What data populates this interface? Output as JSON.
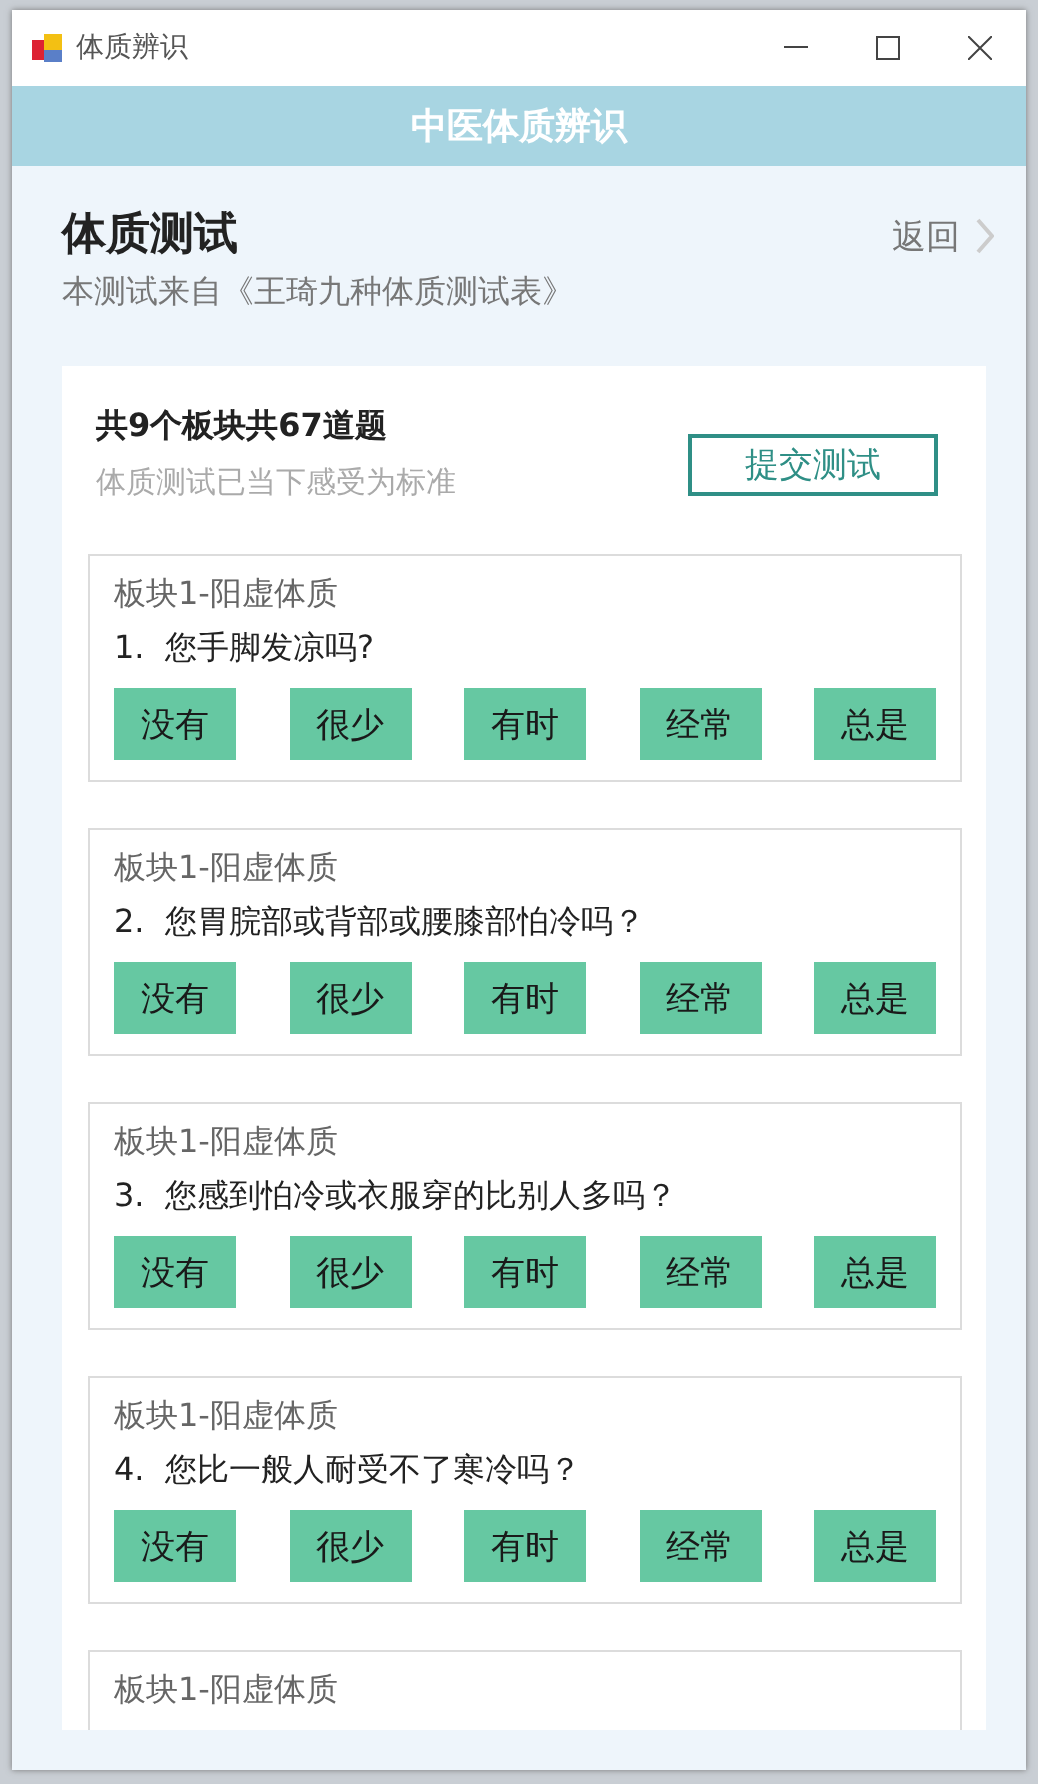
{
  "window": {
    "title": "体质辨识"
  },
  "app_header": {
    "title": "中医体质辨识"
  },
  "page": {
    "title": "体质测试",
    "subtitle": "本测试来自《王琦九种体质测试表》",
    "back_link": "返回"
  },
  "summary": {
    "count": "共9个板块共67道题",
    "hint": "体质测试已当下感受为标准",
    "submit_button": "提交测试"
  },
  "questions": [
    {
      "category": "板块1-阳虚体质",
      "question": "1.  您手脚发凉吗?",
      "options": [
        {
          "label": "没有",
          "selected": false
        },
        {
          "label": "很少",
          "selected": false
        },
        {
          "label": "有时",
          "selected": false
        },
        {
          "label": "经常",
          "selected": false
        },
        {
          "label": "总是",
          "selected": false
        }
      ]
    },
    {
      "category": "板块1-阳虚体质",
      "question": "2.  您胃脘部或背部或腰膝部怕冷吗？",
      "options": [
        {
          "label": "没有",
          "selected": false
        },
        {
          "label": "很少",
          "selected": false
        },
        {
          "label": "有时",
          "selected": false
        },
        {
          "label": "经常",
          "selected": false
        },
        {
          "label": "总是",
          "selected": false
        }
      ]
    },
    {
      "category": "板块1-阳虚体质",
      "question": "3.  您感到怕冷或衣服穿的比别人多吗？",
      "options": [
        {
          "label": "没有",
          "selected": false
        },
        {
          "label": "很少",
          "selected": false
        },
        {
          "label": "有时",
          "selected": false
        },
        {
          "label": "经常",
          "selected": false
        },
        {
          "label": "总是",
          "selected": false
        }
      ]
    },
    {
      "category": "板块1-阳虚体质",
      "question": "4.  您比一般人耐受不了寒冷吗？",
      "options": [
        {
          "label": "没有",
          "selected": false
        },
        {
          "label": "很少",
          "selected": false
        },
        {
          "label": "有时",
          "selected": false
        },
        {
          "label": "经常",
          "selected": false
        },
        {
          "label": "总是",
          "selected": false
        }
      ]
    },
    {
      "category": "板块1-阳虚体质"
    }
  ]
}
